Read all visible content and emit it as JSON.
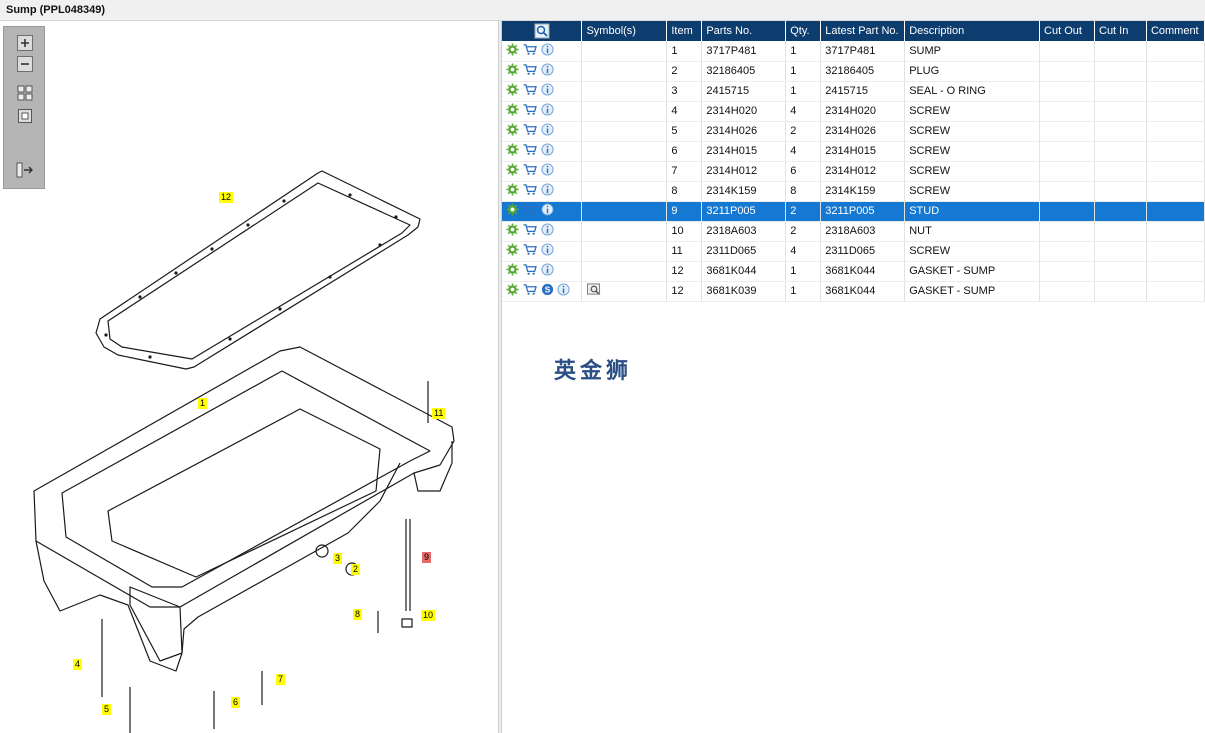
{
  "window": {
    "title": "Sump (PPL048349)"
  },
  "toolbox": {
    "tools": [
      {
        "name": "zoom-in-icon"
      },
      {
        "name": "zoom-out-icon"
      },
      {
        "name": "fit-all-icon"
      },
      {
        "name": "fit-window-icon"
      },
      {
        "name": "toggle-panel-icon"
      }
    ]
  },
  "drawing": {
    "callouts": [
      "12",
      "1",
      "11",
      "3",
      "2",
      "9",
      "8",
      "10",
      "4",
      "7",
      "5",
      "6"
    ],
    "selected_callout": "9"
  },
  "table": {
    "headers": {
      "actions": "",
      "symbols": "Symbol(s)",
      "item": "Item",
      "parts_no": "Parts No.",
      "qty": "Qty.",
      "latest": "Latest Part No.",
      "description": "Description",
      "cut_out": "Cut Out",
      "cut_in": "Cut In",
      "comment": "Comment"
    },
    "rows": [
      {
        "item": "1",
        "parts_no": "3717P481",
        "qty": "1",
        "latest": "3717P481",
        "description": "SUMP",
        "selected": false,
        "extra": false
      },
      {
        "item": "2",
        "parts_no": "32186405",
        "qty": "1",
        "latest": "32186405",
        "description": "PLUG",
        "selected": false,
        "extra": false
      },
      {
        "item": "3",
        "parts_no": "2415715",
        "qty": "1",
        "latest": "2415715",
        "description": "SEAL - O RING",
        "selected": false,
        "extra": false
      },
      {
        "item": "4",
        "parts_no": "2314H020",
        "qty": "4",
        "latest": "2314H020",
        "description": "SCREW",
        "selected": false,
        "extra": false
      },
      {
        "item": "5",
        "parts_no": "2314H026",
        "qty": "2",
        "latest": "2314H026",
        "description": "SCREW",
        "selected": false,
        "extra": false
      },
      {
        "item": "6",
        "parts_no": "2314H015",
        "qty": "4",
        "latest": "2314H015",
        "description": "SCREW",
        "selected": false,
        "extra": false
      },
      {
        "item": "7",
        "parts_no": "2314H012",
        "qty": "6",
        "latest": "2314H012",
        "description": "SCREW",
        "selected": false,
        "extra": false
      },
      {
        "item": "8",
        "parts_no": "2314K159",
        "qty": "8",
        "latest": "2314K159",
        "description": "SCREW",
        "selected": false,
        "extra": false
      },
      {
        "item": "9",
        "parts_no": "3211P005",
        "qty": "2",
        "latest": "3211P005",
        "description": "STUD",
        "selected": true,
        "extra": false
      },
      {
        "item": "10",
        "parts_no": "2318A603",
        "qty": "2",
        "latest": "2318A603",
        "description": "NUT",
        "selected": false,
        "extra": false
      },
      {
        "item": "11",
        "parts_no": "2311D065",
        "qty": "4",
        "latest": "2311D065",
        "description": "SCREW",
        "selected": false,
        "extra": false
      },
      {
        "item": "12",
        "parts_no": "3681K044",
        "qty": "1",
        "latest": "3681K044",
        "description": "GASKET - SUMP",
        "selected": false,
        "extra": false
      },
      {
        "item": "12",
        "parts_no": "3681K039",
        "qty": "1",
        "latest": "3681K044",
        "description": "GASKET - SUMP",
        "selected": false,
        "extra": true
      }
    ]
  },
  "watermark": "英金狮",
  "colors": {
    "header_bg": "#0d3d6f",
    "selected_row": "#1578d2",
    "callout": "#ffff00",
    "callout_selected": "#e56b6b"
  }
}
